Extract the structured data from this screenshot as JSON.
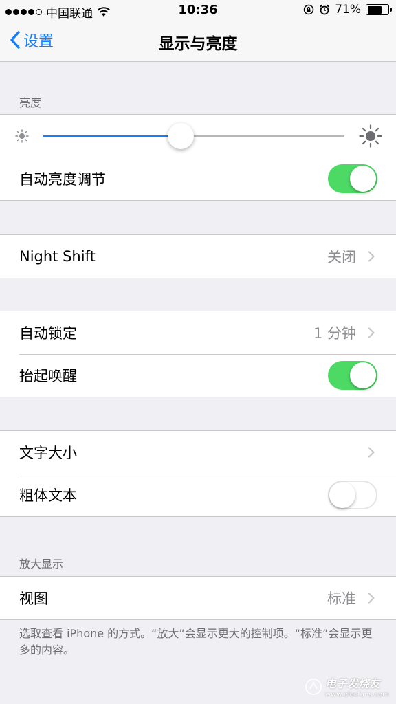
{
  "status_bar": {
    "carrier": "中国联通",
    "time": "10:36",
    "battery": "71%",
    "battery_level": 0.71,
    "signal_bars": 4,
    "icons": [
      "wifi-icon",
      "orientation-lock-icon",
      "alarm-icon",
      "battery-icon"
    ]
  },
  "nav": {
    "back_label": "设置",
    "title": "显示与亮度"
  },
  "brightness": {
    "header": "亮度",
    "level": 0.46,
    "auto_label": "自动亮度调节",
    "auto_on": true
  },
  "night_shift": {
    "label": "Night Shift",
    "value": "关闭"
  },
  "lock": {
    "auto_lock_label": "自动锁定",
    "auto_lock_value": "1 分钟",
    "raise_wake_label": "抬起唤醒",
    "raise_wake_on": true
  },
  "text": {
    "size_label": "文字大小",
    "bold_label": "粗体文本",
    "bold_on": false
  },
  "zoom": {
    "header": "放大显示",
    "view_label": "视图",
    "view_value": "标准",
    "footer": "选取查看 iPhone 的方式。“放大”会显示更大的控制项。“标准”会显示更多的内容。"
  },
  "watermark": {
    "text": "电子发烧友",
    "sub": "www.elecfans.com"
  },
  "colors": {
    "accent": "#157efb",
    "toggle_on": "#4cd964",
    "background": "#efeff4",
    "separator": "#c8c7cc",
    "secondary_text": "#8e8e93"
  }
}
